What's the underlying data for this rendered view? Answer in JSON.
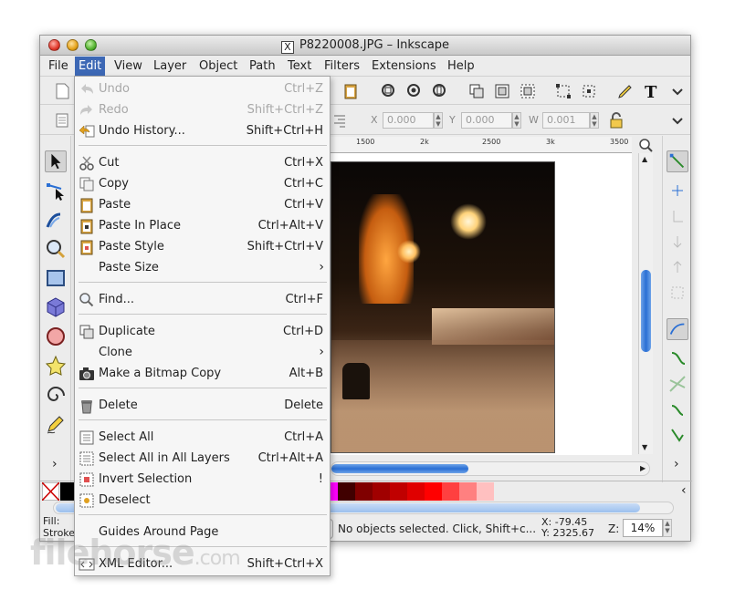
{
  "window": {
    "title": "P8220008.JPG – Inkscape",
    "title_icon": "X"
  },
  "menubar": [
    "File",
    "Edit",
    "View",
    "Layer",
    "Object",
    "Path",
    "Text",
    "Filters",
    "Extensions",
    "Help"
  ],
  "toolbar2": {
    "x_label": "X",
    "x_value": "0.000",
    "y_label": "Y",
    "y_value": "0.000",
    "w_label": "W",
    "w_value": "0.001"
  },
  "ruler": [
    "1500",
    "2k",
    "2500",
    "3k",
    "3500"
  ],
  "palette": [
    "#000000",
    "#ffffff",
    "#808080",
    "#c0c0c0",
    "#800000",
    "#ff0000",
    "#808000",
    "#ffff00",
    "#008000",
    "#00ff00",
    "#008080",
    "#00ffff",
    "#000080",
    "#0000ff",
    "#800080",
    "#ff00ff",
    "#400000",
    "#800000",
    "#a00000",
    "#c00000",
    "#e00000",
    "#ff0000",
    "#ff4040",
    "#ff8080",
    "#ffc0c0"
  ],
  "status": {
    "fill_label": "Fill:",
    "stroke_label": "Stroke",
    "message": "No objects selected. Click, Shift+c...",
    "coord_x": "X:   -79.45",
    "coord_y": "Y: 2325.67",
    "zoom_label": "Z:",
    "zoom_value": "14%"
  },
  "edit_menu": {
    "items": [
      {
        "label": "Undo",
        "shortcut": "Ctrl+Z",
        "icon": "undo-icon",
        "disabled": true
      },
      {
        "label": "Redo",
        "shortcut": "Shift+Ctrl+Z",
        "icon": "redo-icon",
        "disabled": true
      },
      {
        "label": "Undo History...",
        "shortcut": "Shift+Ctrl+H",
        "icon": "undo-history-icon"
      },
      {
        "label": "Cut",
        "shortcut": "Ctrl+X",
        "icon": "scissors-icon"
      },
      {
        "label": "Copy",
        "shortcut": "Ctrl+C",
        "icon": "copy-icon"
      },
      {
        "label": "Paste",
        "shortcut": "Ctrl+V",
        "icon": "paste-icon"
      },
      {
        "label": "Paste In Place",
        "shortcut": "Ctrl+Alt+V",
        "icon": "paste-in-place-icon"
      },
      {
        "label": "Paste Style",
        "shortcut": "Shift+Ctrl+V",
        "icon": "paste-style-icon"
      },
      {
        "label": "Paste Size",
        "shortcut": "",
        "submenu": true
      },
      {
        "label": "Find...",
        "shortcut": "Ctrl+F",
        "icon": "find-icon"
      },
      {
        "label": "Duplicate",
        "shortcut": "Ctrl+D",
        "icon": "duplicate-icon"
      },
      {
        "label": "Clone",
        "shortcut": "",
        "submenu": true
      },
      {
        "label": "Make a Bitmap Copy",
        "shortcut": "Alt+B",
        "icon": "camera-icon"
      },
      {
        "label": "Delete",
        "shortcut": "Delete",
        "icon": "trash-icon"
      },
      {
        "label": "Select All",
        "shortcut": "Ctrl+A",
        "icon": "select-all-icon"
      },
      {
        "label": "Select All in All Layers",
        "shortcut": "Ctrl+Alt+A",
        "icon": "select-all-layers-icon"
      },
      {
        "label": "Invert Selection",
        "shortcut": "!",
        "icon": "invert-selection-icon"
      },
      {
        "label": "Deselect",
        "shortcut": "",
        "icon": "deselect-icon"
      },
      {
        "label": "Guides Around Page",
        "shortcut": ""
      },
      {
        "label": "XML Editor...",
        "shortcut": "Shift+Ctrl+X",
        "icon": "xml-editor-icon"
      }
    ]
  },
  "watermark": {
    "main": "filehorse",
    "sub": ".com"
  }
}
